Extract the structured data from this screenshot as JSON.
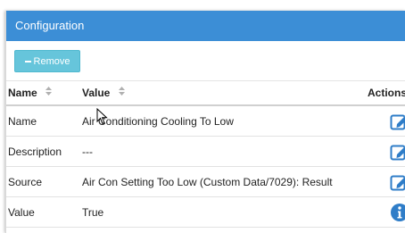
{
  "panel": {
    "title": "Configuration"
  },
  "toolbar": {
    "remove_label": "Remove"
  },
  "table": {
    "headers": {
      "name": "Name",
      "value": "Value",
      "actions": "Actions"
    },
    "rows": [
      {
        "name": "Name",
        "value": "Air Conditioning Cooling To Low",
        "action": "edit-icon"
      },
      {
        "name": "Description",
        "value": "---",
        "action": "edit-icon"
      },
      {
        "name": "Source",
        "value": "Air Con Setting Too Low (Custom Data/7029): Result",
        "action": "edit-icon"
      },
      {
        "name": "Value",
        "value": "True",
        "action": "info-icon"
      }
    ]
  },
  "colors": {
    "header_bg": "#3c8ed6",
    "remove_button_bg": "#66c5db",
    "icon_blue": "#2f7dc8"
  }
}
